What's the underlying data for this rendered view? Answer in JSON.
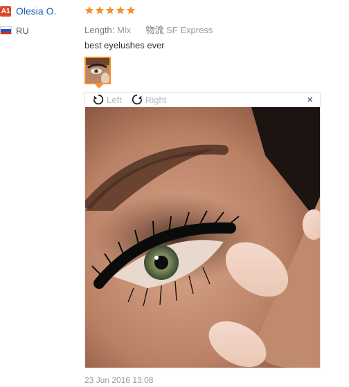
{
  "reviewer": {
    "badge": "A1",
    "name": "Olesia O.",
    "country": "RU"
  },
  "review": {
    "rating": 5,
    "meta": {
      "length_label": "Length:",
      "length_value": "Mix",
      "shipping_label": "物流",
      "shipping_value": "SF Express"
    },
    "text": "best eyelushes ever",
    "date": "23 Jun 2016 13:08"
  },
  "viewer": {
    "rotate_left": "Left",
    "rotate_right": "Right",
    "close": "×"
  },
  "colors": {
    "star": "#f4932a",
    "username": "#1a5fb4",
    "badge": "#d9482b",
    "thumb_border": "#f4932a"
  }
}
